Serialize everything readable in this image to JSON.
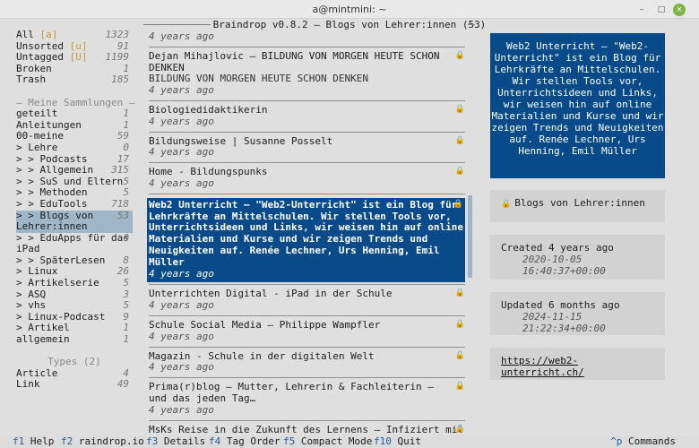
{
  "window": {
    "title": "a@mintmini: ~",
    "minimize_glyph": "–",
    "maximize_glyph": "□",
    "close_glyph": "×"
  },
  "terminal_title": "Braindrop v0.8.2 — Blogs von Lehrer:innen (53)",
  "sidebar": {
    "top_items": [
      {
        "label": "All",
        "tag": "[a]",
        "count": "1323"
      },
      {
        "label": "Unsorted",
        "tag": "[u]",
        "count": "91"
      },
      {
        "label": "Untagged",
        "tag": "[U]",
        "count": "1199"
      },
      {
        "label": "Broken",
        "tag": "",
        "count": "1"
      },
      {
        "label": "Trash",
        "tag": "",
        "count": "185"
      }
    ],
    "collections_header": "— Meine Sammlungen —",
    "collections": [
      {
        "label": "geteilt",
        "count": "1"
      },
      {
        "label": "Anleitungen",
        "count": "1"
      },
      {
        "label": "00-meine",
        "count": "59"
      },
      {
        "label": "> Lehre",
        "count": "0"
      },
      {
        "label": "> > Podcasts",
        "count": "17"
      },
      {
        "label": "> > Allgemein",
        "count": "315"
      },
      {
        "label": "> > SuS und Eltern",
        "count": "5"
      },
      {
        "label": "> > Methoden",
        "count": "5"
      },
      {
        "label": "> > EduTools",
        "count": "718"
      }
    ],
    "selected_collection": {
      "label": "> > Blogs von",
      "label_line2": "Lehrer:innen",
      "count": "53"
    },
    "collections_after": [
      {
        "label": "> > EduApps für das",
        "label_line2": "iPad",
        "count": "0"
      },
      {
        "label": "> > SpäterLesen",
        "count": "8"
      },
      {
        "label": "> Linux",
        "count": "26"
      },
      {
        "label": "> Artikelserie",
        "count": "5"
      },
      {
        "label": "> ASQ",
        "count": "3"
      },
      {
        "label": "> vhs",
        "count": "5"
      },
      {
        "label": "> Linux-Podcast",
        "count": "9"
      },
      {
        "label": "> Artikel",
        "count": "1"
      },
      {
        "label": "allgemein",
        "count": "1"
      }
    ],
    "types_header": "Types (2)",
    "types": [
      {
        "label": "Article",
        "count": "4"
      },
      {
        "label": "Link",
        "count": "49"
      }
    ]
  },
  "list": {
    "items": [
      {
        "title": "",
        "title2": "",
        "age": "4 years ago",
        "lock": false
      },
      {
        "title": "Dejan Mihajlovic — BILDUNG VON MORGEN HEUTE SCHON DENKEN",
        "title2": "BILDUNG VON MORGEN HEUTE SCHON DENKEN",
        "age": "4 years ago",
        "lock": true
      },
      {
        "title": "Biologiedidaktikerin",
        "title2": "",
        "age": "4 years ago",
        "lock": true
      },
      {
        "title": "Bildungsweise | Susanne Posselt",
        "title2": "",
        "age": "4 years ago",
        "lock": true
      },
      {
        "title": "Home - Bildungspunks",
        "title2": "",
        "age": "4 years ago",
        "lock": true
      }
    ],
    "selected": {
      "title": "Web2 Unterricht — \"Web2-Unterricht\" ist ein Blog für Lehrkräfte an Mittelschulen. Wir stellen Tools vor, Unterrichtsideen und Links, wir weisen hin auf online Materialien und Kurse und wir zeigen Trends und Neuigkeiten auf. Renée Lechner, Urs Henning, Emil Müller",
      "age": "4 years ago"
    },
    "items_after": [
      {
        "title": "Unterrichten Digital - iPad in der Schule",
        "title2": "",
        "age": "4 years ago",
        "lock": true
      },
      {
        "title": "Schule Social Media — Philippe Wampfler",
        "title2": "",
        "age": "4 years ago",
        "lock": true
      },
      {
        "title": "Magazin - Schule in der digitalen Welt",
        "title2": "",
        "age": "4 years ago",
        "lock": true
      },
      {
        "title": "Prima(r)blog — Mutter, Lehrerin & Fachleiterin — und das jeden Tag…",
        "title2": "",
        "age": "4 years ago",
        "lock": true
      },
      {
        "title": "MsKs Reise in die Zukunft des Lernens — Infiziert mit dem",
        "title2": "",
        "age": "",
        "lock": true
      }
    ]
  },
  "detail": {
    "description": "Web2 Unterricht — \"Web2-Unterricht\" ist ein Blog für Lehrkräfte an Mittelschulen. Wir stellen Tools vor, Unterrichtsideen und Links, wir weisen hin auf online Materialien und Kurse und wir zeigen Trends und Neuigkeiten auf. Renée Lechner, Urs Henning, Emil Müller",
    "collection": "Blogs von Lehrer:innen",
    "created_label": "Created 4 years ago",
    "created_ts": "2020-10-05 16:40:37+00:00",
    "updated_label": "Updated 6 months ago",
    "updated_ts": "2024-11-15 21:22:34+00:00",
    "url": "https://web2-unterricht.ch/"
  },
  "footer": {
    "keys": [
      {
        "key": "f1",
        "label": "Help"
      },
      {
        "key": "f2",
        "label": "raindrop.io"
      },
      {
        "key": "f3",
        "label": "Details"
      },
      {
        "key": "f4",
        "label": "Tag Order"
      },
      {
        "key": "f5",
        "label": "Compact Mode"
      },
      {
        "key": "f10",
        "label": "Quit"
      }
    ],
    "commands_key": "^p",
    "commands_label": "Commands"
  },
  "colors": {
    "selection_bg": "#084a8a",
    "sidebar_selection_bg": "#9eb6c8",
    "accent_tag": "#c89a3a",
    "footer_key": "#1d5e9e"
  }
}
